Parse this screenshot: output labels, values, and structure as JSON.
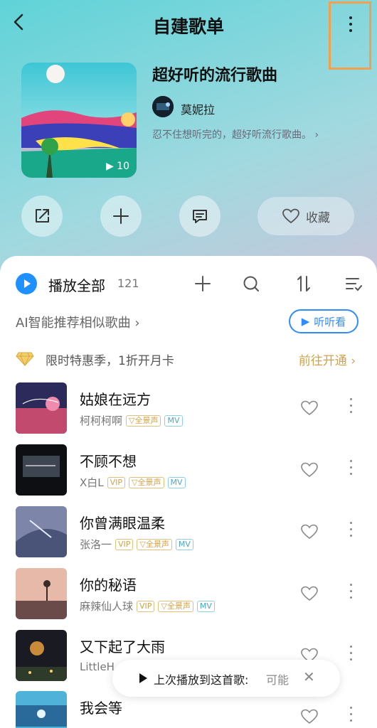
{
  "header": {
    "title": "自建歌单"
  },
  "playlist": {
    "name": "超好听的流行歌曲",
    "play_count": "10",
    "creator": "莫妮拉",
    "description": "忍不住想听完的，超好听流行歌曲。",
    "collect_label": "收藏"
  },
  "list_header": {
    "play_all_label": "播放全部",
    "count": "121"
  },
  "ai_recommend": {
    "label": "AI智能推荐相似歌曲",
    "button_label": "听听看"
  },
  "promo": {
    "text": "限时特惠季，1折开月卡",
    "link": "前往开通"
  },
  "tag_labels": {
    "vip": "VIP",
    "qjs": "全景声",
    "mv": "MV"
  },
  "songs": [
    {
      "title": "姑娘在远方",
      "artist": "柯柯柯啊"
    },
    {
      "title": "不顾不想",
      "artist": "X白L"
    },
    {
      "title": "你曾满眼温柔",
      "artist": "张洛一"
    },
    {
      "title": "你的秘语",
      "artist": "麻辣仙人球"
    },
    {
      "title": "又下起了大雨",
      "artist": "LittleH"
    },
    {
      "title": "我会等",
      "artist": ""
    }
  ],
  "toast": {
    "text": "上次播放到这首歌:",
    "song": "可能"
  },
  "colors": {
    "accent_blue": "#1e90ff",
    "gold": "#d3a24a",
    "highlight_box": "#f0a04e"
  }
}
